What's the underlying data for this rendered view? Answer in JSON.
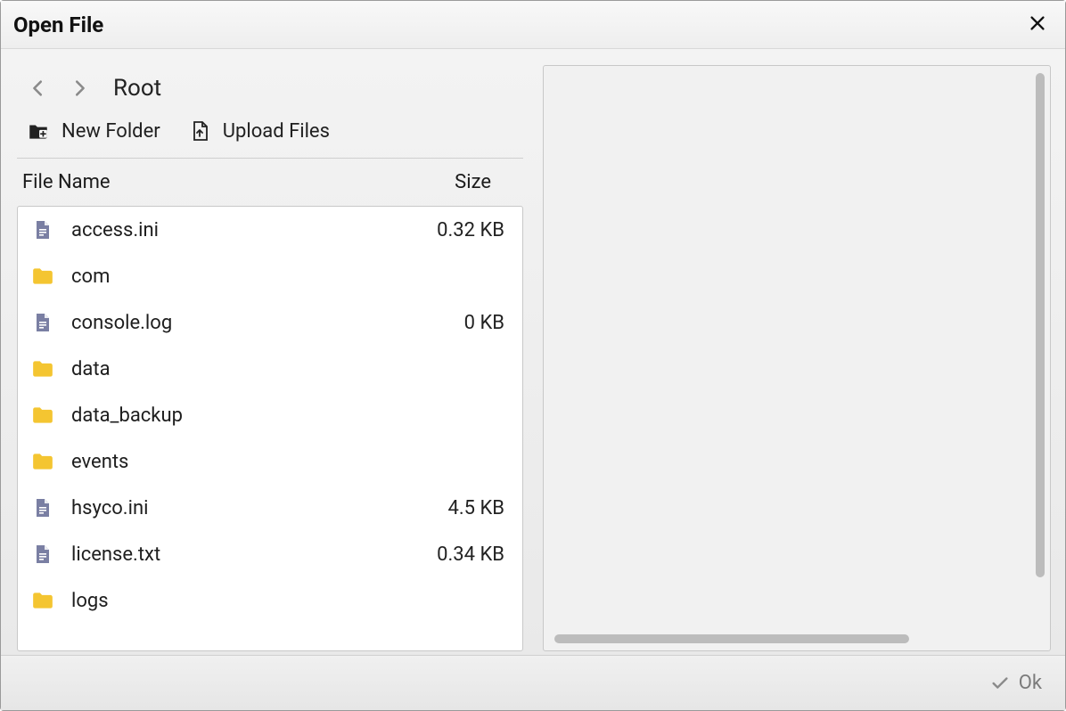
{
  "title": "Open File",
  "breadcrumb": "Root",
  "toolbar": {
    "new_folder_label": "New Folder",
    "upload_label": "Upload Files"
  },
  "columns": {
    "name": "File Name",
    "size": "Size"
  },
  "files": [
    {
      "type": "file",
      "name": "access.ini",
      "size": "0.32 KB"
    },
    {
      "type": "folder",
      "name": "com",
      "size": ""
    },
    {
      "type": "file",
      "name": "console.log",
      "size": "0 KB"
    },
    {
      "type": "folder",
      "name": "data",
      "size": ""
    },
    {
      "type": "folder",
      "name": "data_backup",
      "size": ""
    },
    {
      "type": "folder",
      "name": "events",
      "size": ""
    },
    {
      "type": "file",
      "name": "hsyco.ini",
      "size": "4.5 KB"
    },
    {
      "type": "file",
      "name": "license.txt",
      "size": "0.34 KB"
    },
    {
      "type": "folder",
      "name": "logs",
      "size": ""
    }
  ],
  "footer": {
    "ok_label": "Ok"
  }
}
